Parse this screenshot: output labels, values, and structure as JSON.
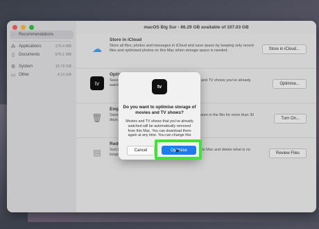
{
  "window_title": "macOS Big Sur - 86.29 GB available of 107.03 GB",
  "sidebar": {
    "items": [
      {
        "label": "Recommendations",
        "size": "",
        "icon": "lightbulb-icon",
        "active": true
      },
      {
        "label": "Applications",
        "size": "175.4 MB",
        "icon": "applications-icon"
      },
      {
        "label": "Documents",
        "size": "576.1 MB",
        "icon": "document-icon"
      },
      {
        "label": "System",
        "size": "15.76 GB",
        "icon": "gear-icon"
      },
      {
        "label": "Other",
        "size": "4.12 GB",
        "icon": "folder-icon"
      }
    ]
  },
  "recommendations": [
    {
      "title": "Store in iCloud",
      "description": "Store all files, photos and messages in iCloud and save space by keeping only recent files and optimised photos on this Mac when storage space is needed.",
      "button": "Store in iCloud...",
      "icon": "icloud-icon"
    },
    {
      "title": "Optimise Storage",
      "description": "Save space by automatically removing Apple TV films and TV shows you've already watched from this Mac.",
      "button": "Optimise...",
      "icon": "apple-tv-icon"
    },
    {
      "title": "Empty Bin Automatically",
      "description": "Save space by automatically erasing items that have been in the Bin for more than 30 days.",
      "button": "Turn On...",
      "icon": "bin-icon"
    },
    {
      "title": "Reduce Clutter",
      "description": "Sort through documents and other content stored on this Mac and delete what is no longer needed.",
      "button": "Review Files",
      "icon": "document-stack-icon"
    }
  ],
  "dialog": {
    "app_icon_label": "tv",
    "title": "Do you want to optimise storage of movies and TV shows?",
    "body": "Movies and TV shows that you've already watched will be automatically removed from this Mac. You can download them again at any time. You can change this later in TV preferences.",
    "cancel_label": "Cancel",
    "confirm_label": "Optimise"
  },
  "colors": {
    "accent": "#1b7cf6",
    "highlight": "#3ee634"
  }
}
